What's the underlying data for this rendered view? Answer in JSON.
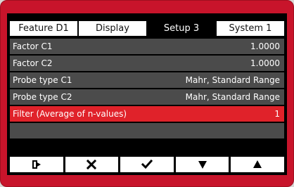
{
  "tabs": [
    {
      "label": "Feature  D1"
    },
    {
      "label": "Display"
    },
    {
      "label": "Setup 3"
    },
    {
      "label": "System 1"
    }
  ],
  "active_tab": "Setup 3",
  "rows": [
    {
      "label": "Factor C1",
      "value": "1.0000"
    },
    {
      "label": "Factor C2",
      "value": "1.0000"
    },
    {
      "label": "Probe type C1",
      "value": "Mahr, Standard Range"
    },
    {
      "label": "Probe type C2",
      "value": "Mahr, Standard Range"
    },
    {
      "label": "Filter (Average of n-values)",
      "value": "1"
    },
    {
      "label": "",
      "value": ""
    }
  ],
  "selected_row": 4,
  "toolbar": {
    "icons": [
      "exit-icon",
      "close-icon",
      "checkmark-icon",
      "arrow-down-icon",
      "arrow-up-icon"
    ]
  },
  "colors": {
    "frame": "#c8142b",
    "selection": "#e0222a",
    "row": "#4b4b4b",
    "screen": "#000000"
  }
}
